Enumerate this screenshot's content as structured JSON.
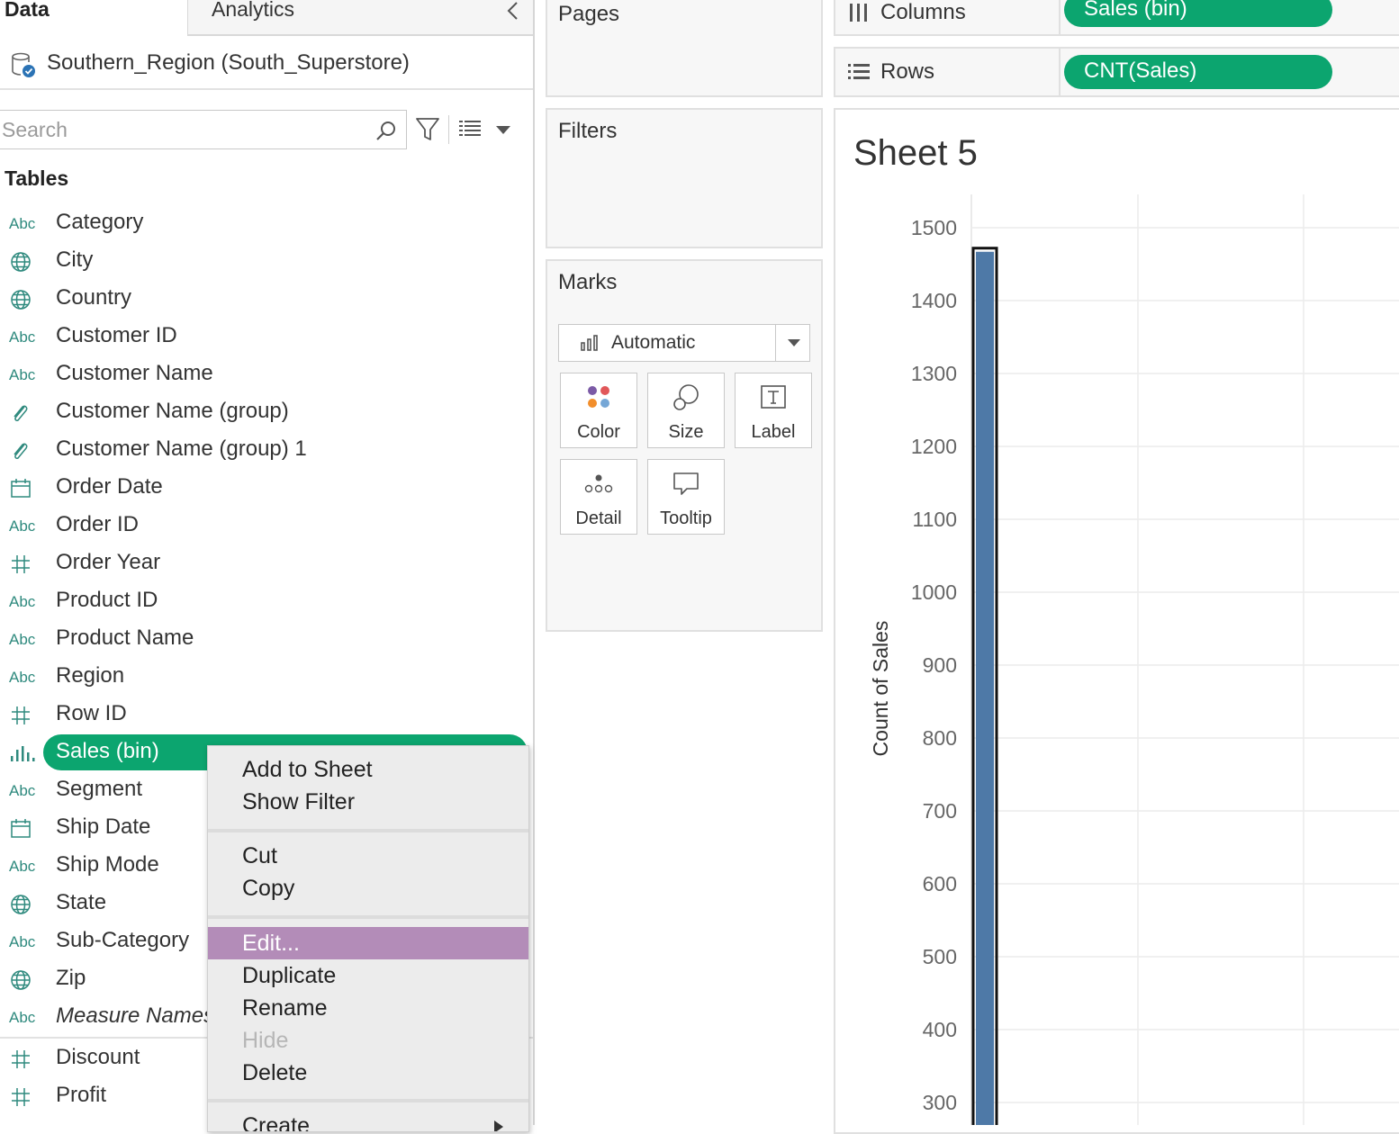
{
  "data_pane": {
    "tab_data": "Data",
    "tab_analytics": "Analytics",
    "datasource": "Southern_Region (South_Superstore)",
    "search_placeholder": "Search",
    "tables_heading": "Tables",
    "fields": [
      {
        "name": "Category",
        "type": "Abc"
      },
      {
        "name": "City",
        "type": "geo"
      },
      {
        "name": "Country",
        "type": "geo"
      },
      {
        "name": "Customer ID",
        "type": "Abc"
      },
      {
        "name": "Customer Name",
        "type": "Abc"
      },
      {
        "name": "Customer Name (group)",
        "type": "group"
      },
      {
        "name": "Customer Name (group) 1",
        "type": "group"
      },
      {
        "name": "Order Date",
        "type": "date"
      },
      {
        "name": "Order ID",
        "type": "Abc"
      },
      {
        "name": "Order Year",
        "type": "#"
      },
      {
        "name": "Product ID",
        "type": "Abc"
      },
      {
        "name": "Product Name",
        "type": "Abc"
      },
      {
        "name": "Region",
        "type": "Abc"
      },
      {
        "name": "Row ID",
        "type": "#"
      },
      {
        "name": "Sales (bin)",
        "type": "bin"
      },
      {
        "name": "Segment",
        "type": "Abc"
      },
      {
        "name": "Ship Date",
        "type": "date"
      },
      {
        "name": "Ship Mode",
        "type": "Abc"
      },
      {
        "name": "State",
        "type": "geo"
      },
      {
        "name": "Sub-Category",
        "type": "Abc"
      },
      {
        "name": "Zip",
        "type": "geo"
      },
      {
        "name": "Measure Names",
        "type": "Abc"
      }
    ],
    "measures": [
      {
        "name": "Discount",
        "type": "#"
      },
      {
        "name": "Profit",
        "type": "#"
      }
    ],
    "abc_glyph": "Abc",
    "hash_glyph": "#"
  },
  "cards": {
    "pages": "Pages",
    "filters": "Filters",
    "marks": "Marks",
    "mark_type": "Automatic",
    "mark_buttons": {
      "color": "Color",
      "size": "Size",
      "label": "Label",
      "detail": "Detail",
      "tooltip": "Tooltip"
    }
  },
  "shelves": {
    "columns_label": "Columns",
    "columns_pill": "Sales (bin)",
    "rows_label": "Rows",
    "rows_pill": "CNT(Sales)"
  },
  "sheet": {
    "title": "Sheet 5"
  },
  "context_menu": {
    "items": [
      "Add to Sheet",
      "Show Filter",
      "Cut",
      "Copy",
      "Edit...",
      "Duplicate",
      "Rename",
      "Hide",
      "Delete",
      "Create"
    ],
    "highlighted": "Edit...",
    "disabled": "Hide"
  },
  "colors": {
    "pill_green": "#0ca56f",
    "menu_highlight": "#b38cb8",
    "bar_fill": "#4e79a7",
    "field_icon_teal": "#2f8a7e"
  },
  "chart_data": {
    "type": "bar",
    "title": "Sheet 5",
    "ylabel": "Count of Sales",
    "yticks": [
      300,
      400,
      500,
      600,
      700,
      800,
      900,
      1000,
      1100,
      1200,
      1300,
      1400,
      1500
    ],
    "visible_ylim": [
      300,
      1500
    ],
    "bars": [
      {
        "value": 1467,
        "selected": true
      }
    ],
    "grid": true
  }
}
